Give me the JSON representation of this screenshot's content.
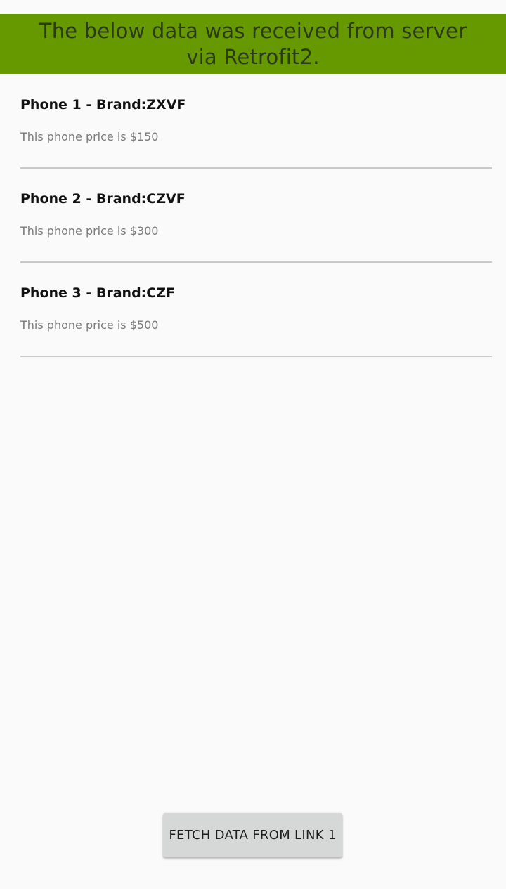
{
  "header": {
    "line1": "The below data was received from server",
    "line2": "via Retrofit2."
  },
  "items": [
    {
      "title": "Phone 1 - Brand:ZXVF",
      "subtitle": "This phone price is $150"
    },
    {
      "title": "Phone 2 - Brand:CZVF",
      "subtitle": "This phone price is $300"
    },
    {
      "title": "Phone 3 - Brand:CZF",
      "subtitle": "This phone price is $500"
    }
  ],
  "button": {
    "label": "FETCH DATA FROM LINK 1"
  },
  "colors": {
    "banner": "#669900",
    "banner_text": "#2b3a17",
    "background": "#fafafa",
    "button": "#d6d7d7",
    "divider": "#c8c8c8"
  }
}
